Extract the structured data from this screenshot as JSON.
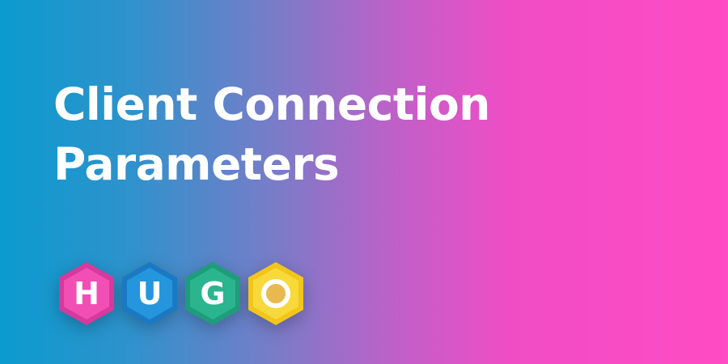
{
  "title": {
    "line1": "Client Connection",
    "line2": "Parameters"
  },
  "logo": {
    "letters": [
      "H",
      "U",
      "G",
      "O"
    ],
    "colors": {
      "h_outer": "#d63a9c",
      "h_inner": "#f24fb4",
      "u_outer": "#1b79c4",
      "u_inner": "#2596dd",
      "g_outer": "#1f9c7a",
      "g_inner": "#2bb58f",
      "o_outer": "#f2c51b",
      "o_inner": "#f8d93b",
      "o_dot": "#e8b94e"
    }
  },
  "colors": {
    "background_start": "#0b9bce",
    "background_end": "#ff4bc4",
    "title_text": "#ffffff"
  }
}
